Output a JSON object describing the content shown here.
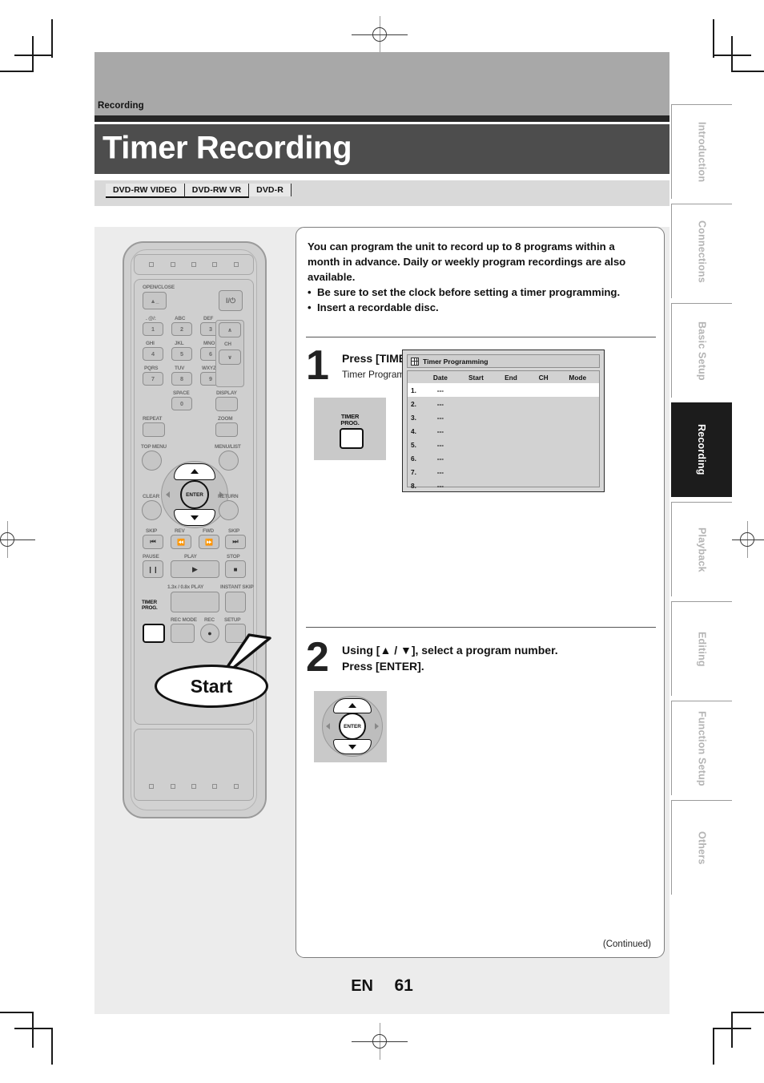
{
  "header": {
    "section": "Recording",
    "title": "Timer Recording",
    "disc_badges": [
      "DVD-RW VIDEO",
      "DVD-RW VR",
      "DVD-R"
    ]
  },
  "intro": {
    "paragraph": "You can program the unit to record up to 8 programs within a month in advance. Daily or weekly program recordings are also available.",
    "bullets": [
      "Be sure to set the clock before setting a timer programming.",
      "Insert a recordable disc."
    ]
  },
  "steps": [
    {
      "number": "1",
      "heading": "Press [TIMER PROG.].",
      "subtext": "Timer Programming list will appear.",
      "key_label": "TIMER\nPROG."
    },
    {
      "number": "2",
      "heading_line1": "Using [▲ / ▼], select a program number.",
      "heading_line2": "Press [ENTER].",
      "enter_label": "ENTER"
    }
  ],
  "osd": {
    "title": "Timer Programming",
    "icon": "grid-icon",
    "columns": [
      "Date",
      "Start",
      "End",
      "CH",
      "Mode"
    ],
    "rows": [
      {
        "no": "1.",
        "date": "---",
        "start": "",
        "end": "",
        "ch": "",
        "mode": "",
        "selected": true
      },
      {
        "no": "2.",
        "date": "---",
        "start": "",
        "end": "",
        "ch": "",
        "mode": "",
        "selected": false
      },
      {
        "no": "3.",
        "date": "---",
        "start": "",
        "end": "",
        "ch": "",
        "mode": "",
        "selected": false
      },
      {
        "no": "4.",
        "date": "---",
        "start": "",
        "end": "",
        "ch": "",
        "mode": "",
        "selected": false
      },
      {
        "no": "5.",
        "date": "---",
        "start": "",
        "end": "",
        "ch": "",
        "mode": "",
        "selected": false
      },
      {
        "no": "6.",
        "date": "---",
        "start": "",
        "end": "",
        "ch": "",
        "mode": "",
        "selected": false
      },
      {
        "no": "7.",
        "date": "---",
        "start": "",
        "end": "",
        "ch": "",
        "mode": "",
        "selected": false
      },
      {
        "no": "8.",
        "date": "---",
        "start": "",
        "end": "",
        "ch": "",
        "mode": "",
        "selected": false
      }
    ]
  },
  "remote": {
    "callout": "Start",
    "labels": {
      "open_close": "OPEN/CLOSE",
      "power": "I/⏻",
      "k1_top": ". @/:",
      "k2_top": "ABC",
      "k3_top": "DEF",
      "k4_top": "GHI",
      "k5_top": "JKL",
      "k6_top": "MNO",
      "k7_top": "PQRS",
      "k8_top": "TUV",
      "k9_top": "WXYZ",
      "k0_top": "SPACE",
      "ch": "CH",
      "display": "DISPLAY",
      "repeat": "REPEAT",
      "zoom": "ZOOM",
      "top_menu": "TOP MENU",
      "menu_list": "MENU/LIST",
      "clear": "CLEAR",
      "return": "RETURN",
      "enter": "ENTER",
      "skip_back": "SKIP",
      "rev": "REV",
      "fwd": "FWD",
      "skip_fwd": "SKIP",
      "pause": "PAUSE",
      "play": "PLAY",
      "stop": "STOP",
      "speed_play": "1.3x / 0.8x PLAY",
      "instant_skip": "INSTANT SKIP",
      "timer_prog": "TIMER\nPROG.",
      "rec_mode": "REC MODE",
      "rec": "REC",
      "setup": "SETUP"
    },
    "keys": {
      "n1": "1",
      "n2": "2",
      "n3": "3",
      "n4": "4",
      "n5": "5",
      "n6": "6",
      "n7": "7",
      "n8": "8",
      "n9": "9",
      "n0": "0"
    }
  },
  "sidebar": {
    "tabs": [
      {
        "label": "Introduction",
        "active": false
      },
      {
        "label": "Connections",
        "active": false
      },
      {
        "label": "Basic Setup",
        "active": false
      },
      {
        "label": "Recording",
        "active": true
      },
      {
        "label": "Playback",
        "active": false
      },
      {
        "label": "Editing",
        "active": false
      },
      {
        "label": "Function Setup",
        "active": false
      },
      {
        "label": "Others",
        "active": false
      }
    ]
  },
  "footer": {
    "continued": "(Continued)",
    "lang": "EN",
    "page": "61"
  },
  "colors": {
    "header_band": "#a8a8a8",
    "title_band": "#4d4d4d",
    "disc_band": "#d9d9d9",
    "content_bg": "#ececec",
    "active_tab": "#1c1c1c"
  }
}
